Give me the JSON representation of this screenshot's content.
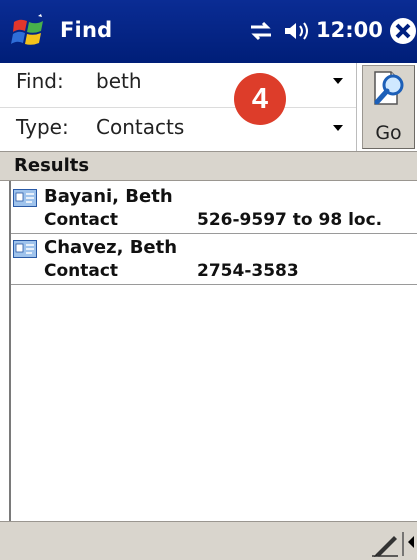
{
  "titlebar": {
    "title": "Find",
    "time": "12:00",
    "icons": [
      "windows-start-icon",
      "connectivity-icon",
      "volume-icon",
      "close-icon"
    ]
  },
  "form": {
    "find_label": "Find:",
    "find_value": "beth",
    "type_label": "Type:",
    "type_value": "Contacts",
    "go_label": "Go"
  },
  "badge": {
    "number": "4",
    "color": "#dd3d2a"
  },
  "results": {
    "header": "Results",
    "items": [
      {
        "name": "Bayani, Beth",
        "type": "Contact",
        "detail": "526-9597 to 98 loc."
      },
      {
        "name": "Chavez, Beth",
        "type": "Contact",
        "detail": "2754-3583"
      }
    ]
  },
  "colors": {
    "titlebar": "#001e78",
    "chrome": "#d9d5cd"
  }
}
